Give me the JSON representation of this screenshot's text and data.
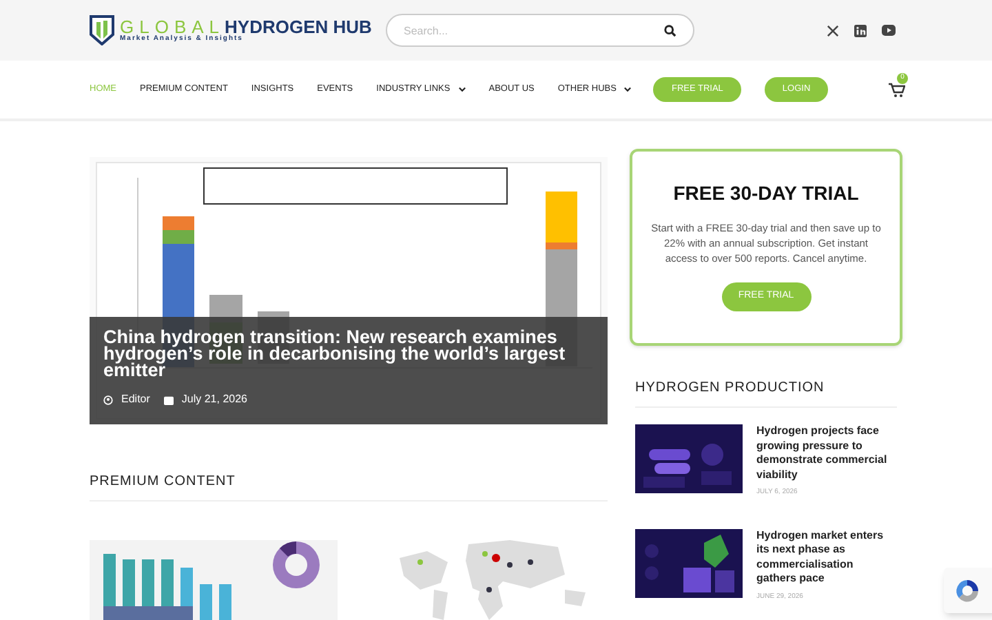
{
  "logo": {
    "word_1": "GLOBAL",
    "word_2": "HYDROGEN HUB",
    "tagline": "Market Analysis & Insights"
  },
  "search": {
    "placeholder": "Search..."
  },
  "nav": [
    {
      "label": "HOME",
      "selected": true,
      "dropdown": false
    },
    {
      "label": "PREMIUM CONTENT",
      "selected": false,
      "dropdown": false
    },
    {
      "label": "INSIGHTS",
      "selected": false,
      "dropdown": false
    },
    {
      "label": "EVENTS",
      "selected": false,
      "dropdown": false
    },
    {
      "label": "INDUSTRY LINKS",
      "selected": false,
      "dropdown": true
    },
    {
      "label": "ABOUT US",
      "selected": false,
      "dropdown": false
    },
    {
      "label": "OTHER HUBS",
      "selected": false,
      "dropdown": true
    }
  ],
  "nav_buttons": [
    "FREE TRIAL",
    "LOGIN"
  ],
  "cart_count": "0",
  "hero": {
    "title": "China hydrogen transition: New research examines hydrogen’s role in decarbonising the world’s largest emitter",
    "author": "Editor",
    "date": "July 21, 2026"
  },
  "trial_card": {
    "title": "FREE 30-DAY TRIAL",
    "text": "Start with a FREE 30-day trial and then save up to 22% with an annual subscription. Get instant access to over 500 reports. Cancel anytime.",
    "button": "FREE TRIAL"
  },
  "premium": {
    "heading": "PREMIUM CONTENT"
  },
  "production": {
    "heading": "HYDROGEN PRODUCTION",
    "articles": [
      {
        "title": "Hydrogen projects face growing pressure to demonstrate commercial viability",
        "date": "JULY 6, 2026"
      },
      {
        "title": "Hydrogen market enters its next phase as commercialisation gathers pace",
        "date": "JUNE 29, 2026"
      }
    ]
  }
}
